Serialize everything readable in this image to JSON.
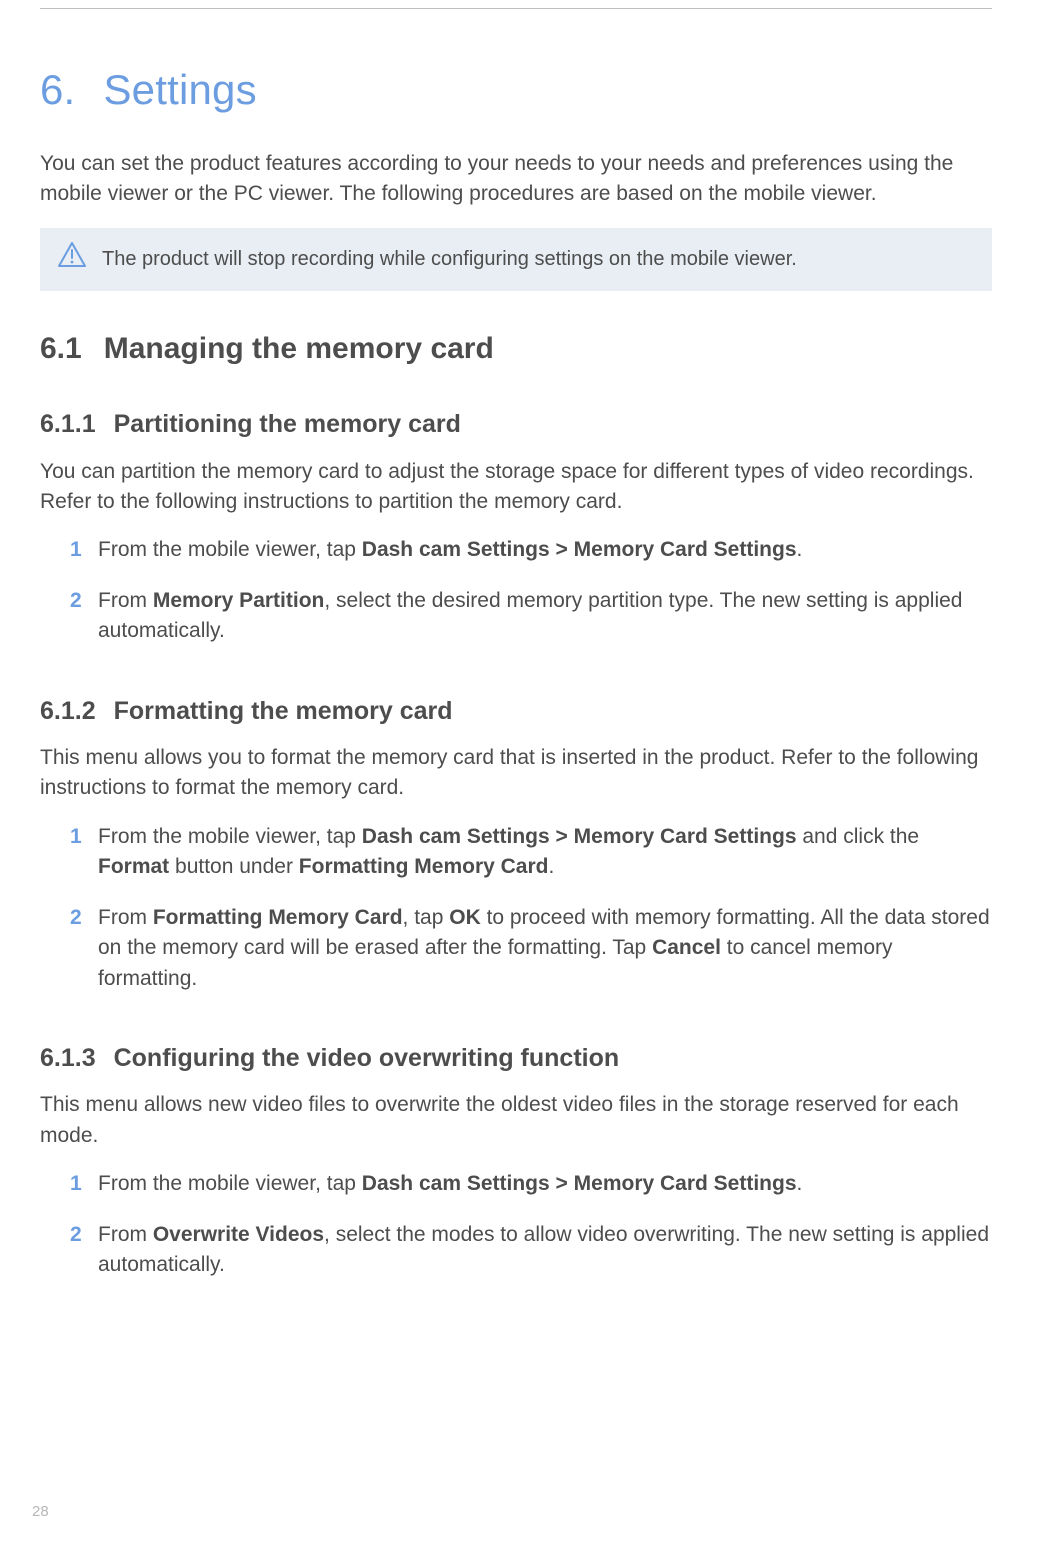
{
  "page_number": "28",
  "chapter": {
    "number": "6.",
    "title": "Settings"
  },
  "intro": "You can set the product features according to your needs to your needs and preferences using the mobile viewer or the PC viewer. The following procedures are based on the mobile viewer.",
  "notice_text": "The product will stop recording while configuring settings on the mobile viewer.",
  "section_6_1": {
    "number": "6.1",
    "title": "Managing the memory card"
  },
  "sub_611": {
    "number": "6.1.1",
    "title": "Partitioning the memory card",
    "intro": "You can partition the memory card to adjust the storage space for different types of video recordings. Refer to the following instructions to partition the memory card.",
    "step1_prefix": "From the mobile viewer, tap ",
    "nav_a": "Dash cam Settings",
    "chev": ">",
    "nav_b": "Memory Card Settings",
    "step1_suffix": ".",
    "step2_prefix": "From ",
    "step2_bold": "Memory Partition",
    "step2_suffix": ", select the desired memory partition type. The new setting is applied automatically."
  },
  "sub_612": {
    "number": "6.1.2",
    "title": "Formatting the memory card",
    "intro": "This menu allows you to format the memory card that is inserted in the product. Refer to the following instructions to format the memory card.",
    "step1_prefix": "From the mobile viewer, tap ",
    "nav_a": "Dash cam Settings",
    "chev": ">",
    "nav_b": "Memory Card Settings",
    "step1_mid": " and click the ",
    "step1_bold_format": "Format",
    "step1_mid2": " button under ",
    "step1_bold_fmc": "Formatting Memory Card",
    "step1_suffix": ".",
    "step2_prefix": "From ",
    "step2_bold_fmc": "Formatting Memory Card",
    "step2_mid": ", tap ",
    "step2_ok": "OK",
    "step2_mid2": " to proceed with memory formatting. All the data stored on the memory card will be erased after the formatting. Tap ",
    "step2_cancel": "Cancel",
    "step2_suffix": " to cancel memory formatting."
  },
  "sub_613": {
    "number": "6.1.3",
    "title": "Configuring the video overwriting function",
    "intro": "This menu allows new video files to overwrite the oldest video files in the storage reserved for each mode.",
    "step1_prefix": "From the mobile viewer, tap ",
    "nav_a": "Dash cam Settings",
    "chev": ">",
    "nav_b": "Memory Card Settings",
    "step1_suffix": ".",
    "step2_prefix": "From ",
    "step2_bold": "Overwrite Videos",
    "step2_suffix": ", select the modes to allow video overwriting. The new setting is applied automatically."
  }
}
